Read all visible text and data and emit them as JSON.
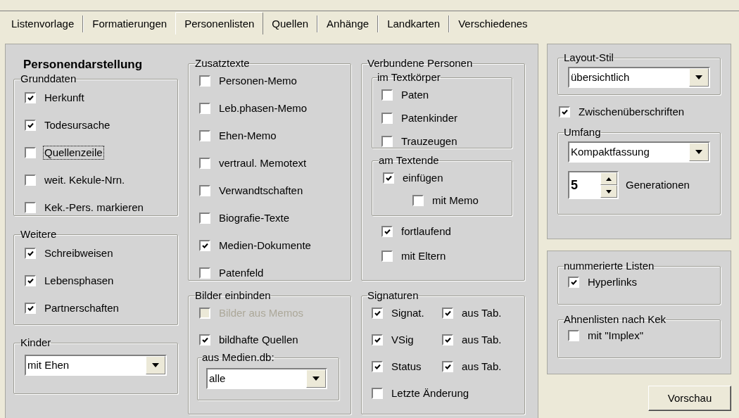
{
  "tabs": [
    {
      "label": "Listenvorlage",
      "selected": false
    },
    {
      "label": "Formatierungen",
      "selected": false
    },
    {
      "label": "Personenlisten",
      "selected": true
    },
    {
      "label": "Quellen",
      "selected": false
    },
    {
      "label": "Anhänge",
      "selected": false
    },
    {
      "label": "Landkarten",
      "selected": false
    },
    {
      "label": "Verschiedenes",
      "selected": false
    }
  ],
  "heading": "Personendarstellung",
  "grunddaten": {
    "title": "Grunddaten",
    "options": [
      {
        "label": "Herkunft",
        "checked": true,
        "focused": false
      },
      {
        "label": "Todesursache",
        "checked": true,
        "focused": false
      },
      {
        "label": "Quellenzeile",
        "checked": false,
        "focused": true
      },
      {
        "label": "weit. Kekule-Nrn.",
        "checked": false,
        "focused": false
      },
      {
        "label": "Kek.-Pers. markieren",
        "checked": false,
        "focused": false
      }
    ]
  },
  "weitere": {
    "title": "Weitere",
    "options": [
      {
        "label": "Schreibweisen",
        "checked": true
      },
      {
        "label": "Lebensphasen",
        "checked": true
      },
      {
        "label": "Partnerschaften",
        "checked": true
      }
    ]
  },
  "kinder": {
    "title": "Kinder",
    "value": "mit Ehen"
  },
  "zusatztexte": {
    "title": "Zusatztexte",
    "options": [
      {
        "label": "Personen-Memo",
        "checked": false
      },
      {
        "label": "Leb.phasen-Memo",
        "checked": false
      },
      {
        "label": "Ehen-Memo",
        "checked": false
      },
      {
        "label": "vertraul. Memotext",
        "checked": false
      },
      {
        "label": "Verwandtschaften",
        "checked": false
      },
      {
        "label": "Biografie-Texte",
        "checked": false
      },
      {
        "label": "Medien-Dokumente",
        "checked": true
      },
      {
        "label": "Patenfeld",
        "checked": false
      }
    ]
  },
  "bilder": {
    "title": "Bilder einbinden",
    "options": [
      {
        "label": "Bilder aus Memos",
        "checked": false,
        "disabled": true
      },
      {
        "label": "bildhafte Quellen",
        "checked": true,
        "disabled": false
      }
    ],
    "medien": {
      "title": "aus Medien.db:",
      "value": "alle"
    }
  },
  "verbundene": {
    "title": "Verbundene Personen",
    "textkoerper": {
      "title": "im Textkörper",
      "options": [
        {
          "label": "Paten",
          "checked": false
        },
        {
          "label": "Patenkinder",
          "checked": false
        },
        {
          "label": "Trauzeugen",
          "checked": false
        }
      ]
    },
    "textende": {
      "title": "am Textende",
      "options": [
        {
          "label": "einfügen",
          "checked": true,
          "children": [
            {
              "label": "mit Memo",
              "checked": false
            }
          ]
        }
      ]
    },
    "options": [
      {
        "label": "fortlaufend",
        "checked": true
      },
      {
        "label": "mit Eltern",
        "checked": false
      }
    ]
  },
  "signaturen": {
    "title": "Signaturen",
    "rows": [
      {
        "label": "Signat.",
        "checked": true,
        "tab_label": "aus Tab.",
        "tab_checked": true
      },
      {
        "label": "VSig",
        "checked": true,
        "tab_label": "aus Tab.",
        "tab_checked": true
      },
      {
        "label": "Status",
        "checked": true,
        "tab_label": "aus Tab.",
        "tab_checked": true
      }
    ],
    "last_change": {
      "label": "Letzte Änderung",
      "checked": false
    }
  },
  "layout_stil": {
    "title": "Layout-Stil",
    "value": "übersichtlich"
  },
  "zwischen": {
    "label": "Zwischenüberschriften",
    "checked": true
  },
  "umfang": {
    "title": "Umfang",
    "value": "Kompaktfassung",
    "spinner_value": "5",
    "spinner_label": "Generationen"
  },
  "nummerierte": {
    "title": "nummerierte Listen",
    "options": [
      {
        "label": "Hyperlinks",
        "checked": true
      }
    ]
  },
  "ahnenlisten": {
    "title": "Ahnenlisten nach Kek",
    "options": [
      {
        "label": "mit \"Implex\"",
        "checked": false
      }
    ]
  },
  "preview_button": "Vorschau"
}
